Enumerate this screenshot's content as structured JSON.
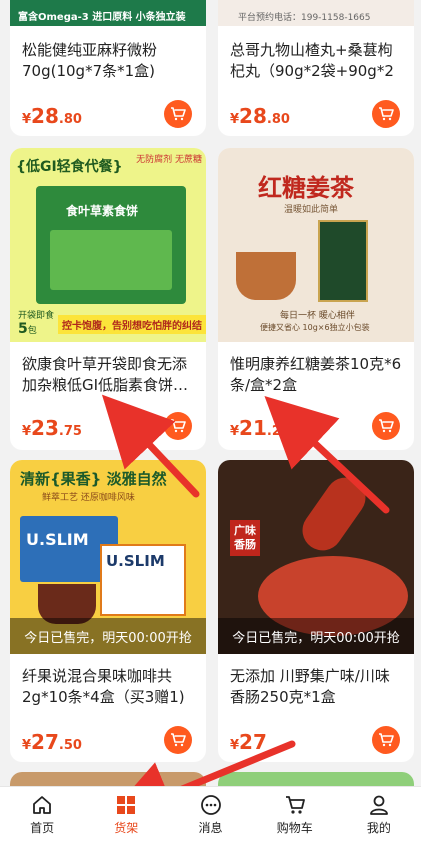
{
  "colors": {
    "accent": "#e8481c",
    "cart": "#ff5a1f",
    "arrow": "#e8322a"
  },
  "products": [
    {
      "title": "松能健纯亚麻籽微粉70g(10g*7条*1盒)（加…",
      "price_int": "28",
      "price_dec": ".80",
      "currency": "¥",
      "banner": "富含Omega-3   进口原料   小条独立装",
      "sold_out": false
    },
    {
      "title": "总哥九物山楂丸+桑葚枸杞丸（90g*2袋+90g*2袋…",
      "price_int": "28",
      "price_dec": ".80",
      "currency": "¥",
      "banner": "平台预约电话：199-1158-1665",
      "sold_out": false
    },
    {
      "title": "欲康食叶草开袋即食无添加杂粮低GI低脂素食饼…",
      "price_int": "23",
      "price_dec": ".75",
      "currency": "¥",
      "badge": "{低GI轻食代餐}",
      "badge2": "无防腐剂 无蔗糖",
      "pkg_label": "食叶草素食饼",
      "tag_open": "开袋即食",
      "tag_count": "5",
      "tag_unit": "包",
      "slogan": "控卡饱腹，告别想吃怕胖的纠结",
      "sold_out": false
    },
    {
      "title": "惟明康养红糖姜茶10克*6条/盒*2盒",
      "price_int": "21",
      "price_dec": ".20",
      "currency": "¥",
      "headline": "红糖姜茶",
      "subline": "温暖如此简单",
      "caption1": "每日一杯 暖心相伴",
      "caption2": "便捷又省心 10g×6独立小包装",
      "sold_out": false
    },
    {
      "title": "纤果说混合果味咖啡共2g*10条*4盒（买3赠1)",
      "price_int": "27",
      "price_dec": ".50",
      "currency": "¥",
      "headline": "清新{果香} 淡雅自然",
      "subline": "鲜萃工艺  还原咖啡风味",
      "brand": "U.SLIM",
      "sold_out": true,
      "sold_text": "今日已售完，明天00:00开抢"
    },
    {
      "title": "无添加 川野集广味/川味香肠250克*1盒",
      "price_int": "27",
      "price_dec": "",
      "currency": "¥",
      "badge": "广味香肠",
      "sold_out": true,
      "sold_text": "今日已售完，明天00:00开抢"
    }
  ],
  "tabbar": [
    {
      "label": "首页",
      "icon": "home-icon",
      "active": false
    },
    {
      "label": "货架",
      "icon": "shelf-grid-icon",
      "active": true
    },
    {
      "label": "消息",
      "icon": "message-icon",
      "active": false
    },
    {
      "label": "购物车",
      "icon": "cart-icon",
      "active": false
    },
    {
      "label": "我的",
      "icon": "user-icon",
      "active": false
    }
  ]
}
